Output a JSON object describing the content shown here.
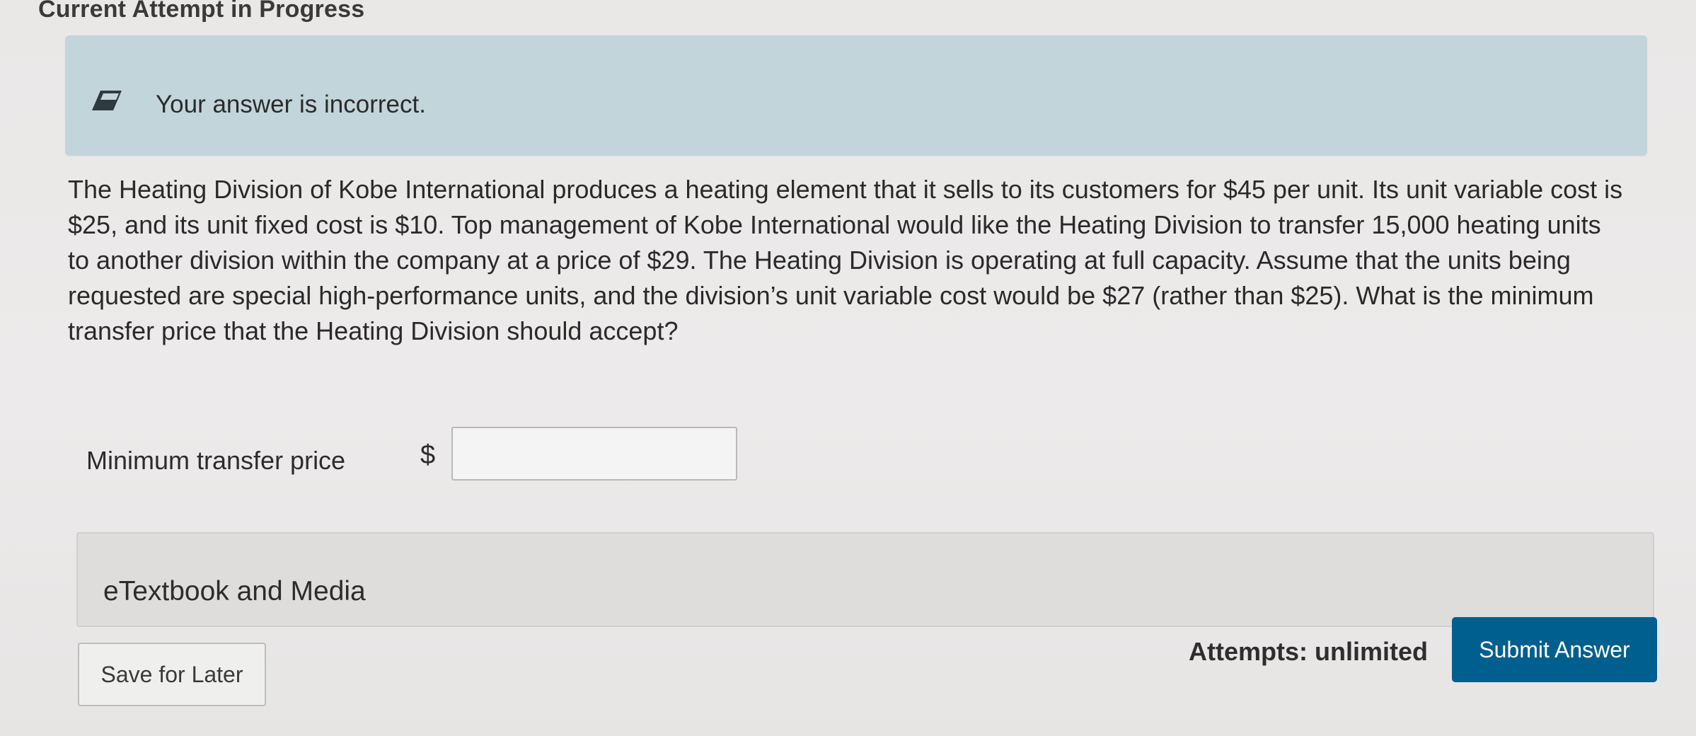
{
  "header": {
    "title": "Current Attempt in Progress"
  },
  "feedback": {
    "icon": "pencil-icon",
    "message": "Your answer is incorrect."
  },
  "question": {
    "text": "The Heating Division of Kobe International produces a heating element that it sells to its customers for $45 per unit. Its unit variable cost is $25, and its unit fixed cost is $10. Top management of Kobe International would like the Heating Division to transfer 15,000 heating units to another division within the company at a price of $29. The Heating Division is operating at full capacity. Assume that the units being requested are special high-performance units, and the division’s unit variable cost would be $27 (rather than $25). What is the minimum transfer price that the Heating Division should accept?"
  },
  "answer": {
    "label": "Minimum transfer price",
    "currency": "$",
    "value": ""
  },
  "resources": {
    "label": "eTextbook and Media"
  },
  "footer": {
    "save_label": "Save for Later",
    "attempts_text": "Attempts: unlimited",
    "submit_label": "Submit Answer"
  },
  "colors": {
    "feedback_bg": "#c2d5db",
    "submit_bg": "#005f8e"
  }
}
